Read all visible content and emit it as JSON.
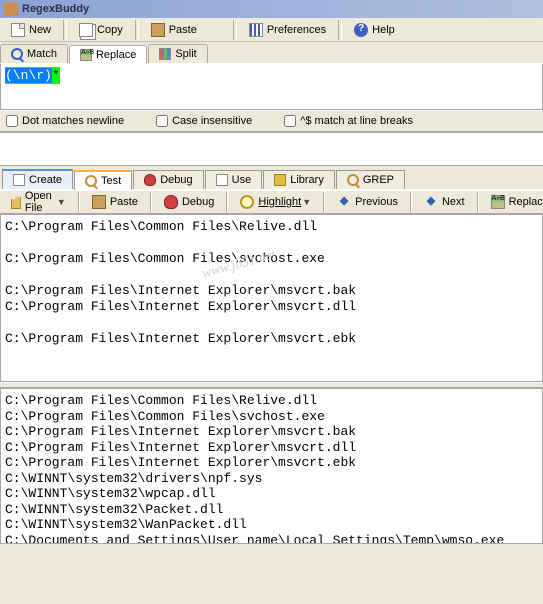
{
  "title": "RegexBuddy",
  "mainToolbar": {
    "new": "New",
    "copy": "Copy",
    "paste": "Paste",
    "preferences": "Preferences",
    "help": "Help"
  },
  "tabs1": {
    "match": "Match",
    "replace": "Replace",
    "split": "Split"
  },
  "regex": {
    "grp": "(\\n\\r)",
    "post": "*"
  },
  "options": {
    "dotnl": "Dot matches newline",
    "ci": "Case insensitive",
    "eol": "^$ match at line breaks"
  },
  "tabs2": {
    "create": "Create",
    "test": "Test",
    "debug": "Debug",
    "use": "Use",
    "library": "Library",
    "grep": "GREP"
  },
  "toolbar2": {
    "openfile": "Open File",
    "paste": "Paste",
    "debug": "Debug",
    "highlight": "Highlight",
    "previous": "Previous",
    "next": "Next",
    "replace": "Replace"
  },
  "output1": [
    "C:\\Program Files\\Common Files\\Relive.dll",
    "",
    "C:\\Program Files\\Common Files\\svchost.exe",
    "",
    "C:\\Program Files\\Internet Explorer\\msvcrt.bak",
    "C:\\Program Files\\Internet Explorer\\msvcrt.dll",
    "",
    "C:\\Program Files\\Internet Explorer\\msvcrt.ebk"
  ],
  "watermark": "www.jb51.net",
  "output2": [
    "C:\\Program Files\\Common Files\\Relive.dll",
    "C:\\Program Files\\Common Files\\svchost.exe",
    "C:\\Program Files\\Internet Explorer\\msvcrt.bak",
    "C:\\Program Files\\Internet Explorer\\msvcrt.dll",
    "C:\\Program Files\\Internet Explorer\\msvcrt.ebk",
    "C:\\WINNT\\system32\\drivers\\npf.sys",
    "C:\\WINNT\\system32\\wpcap.dll",
    "C:\\WINNT\\system32\\Packet.dll",
    "C:\\WINNT\\system32\\WanPacket.dll",
    "C:\\Documents and Settings\\User name\\Local Settings\\Temp\\wmso.exe"
  ]
}
